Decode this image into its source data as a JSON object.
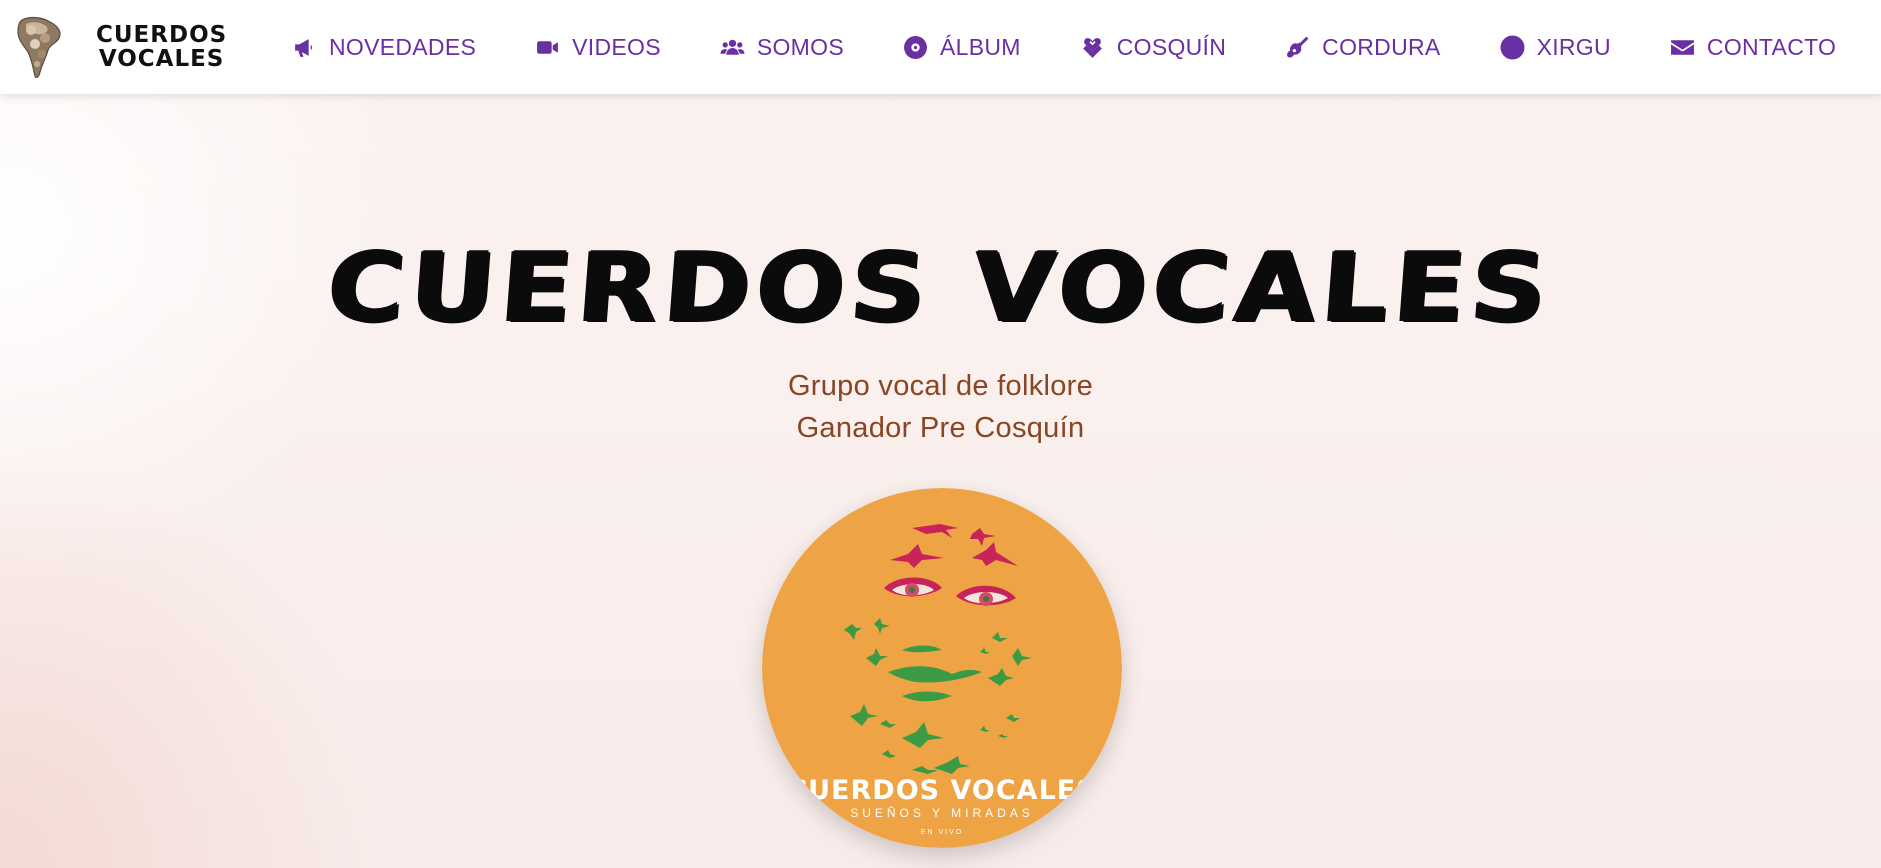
{
  "brand": {
    "logo_icon": "south-america-collage-logo",
    "line1": "CUERDOS",
    "line2": "VOCALES"
  },
  "nav": {
    "items": [
      {
        "label": "NOVEDADES",
        "icon": "megaphone-icon"
      },
      {
        "label": "VIDEOS",
        "icon": "video-camera-icon"
      },
      {
        "label": "SOMOS",
        "icon": "users-icon"
      },
      {
        "label": "ÁLBUM",
        "icon": "compact-disc-icon"
      },
      {
        "label": "COSQUÍN",
        "icon": "layered-heart-icon"
      },
      {
        "label": "CORDURA",
        "icon": "guitar-icon"
      },
      {
        "label": "XIRGU",
        "icon": "circle-icon"
      },
      {
        "label": "CONTACTO",
        "icon": "envelope-icon"
      }
    ]
  },
  "hero": {
    "title": "CUERDOS VOCALES",
    "subtitle_line1": "Grupo vocal de folklore",
    "subtitle_line2": "Ganador Pre Cosquín"
  },
  "album": {
    "title": "CUERDOS VOCALES",
    "subtitle": "SUEÑOS Y MIRADAS",
    "tagline": "EN VIVO"
  },
  "colors": {
    "nav_accent": "#6a2fa3",
    "subtitle": "#8a4522",
    "album_background": "#eea444",
    "album_birds_top": "#c8245a",
    "album_birds_bottom": "#3c9a45"
  }
}
